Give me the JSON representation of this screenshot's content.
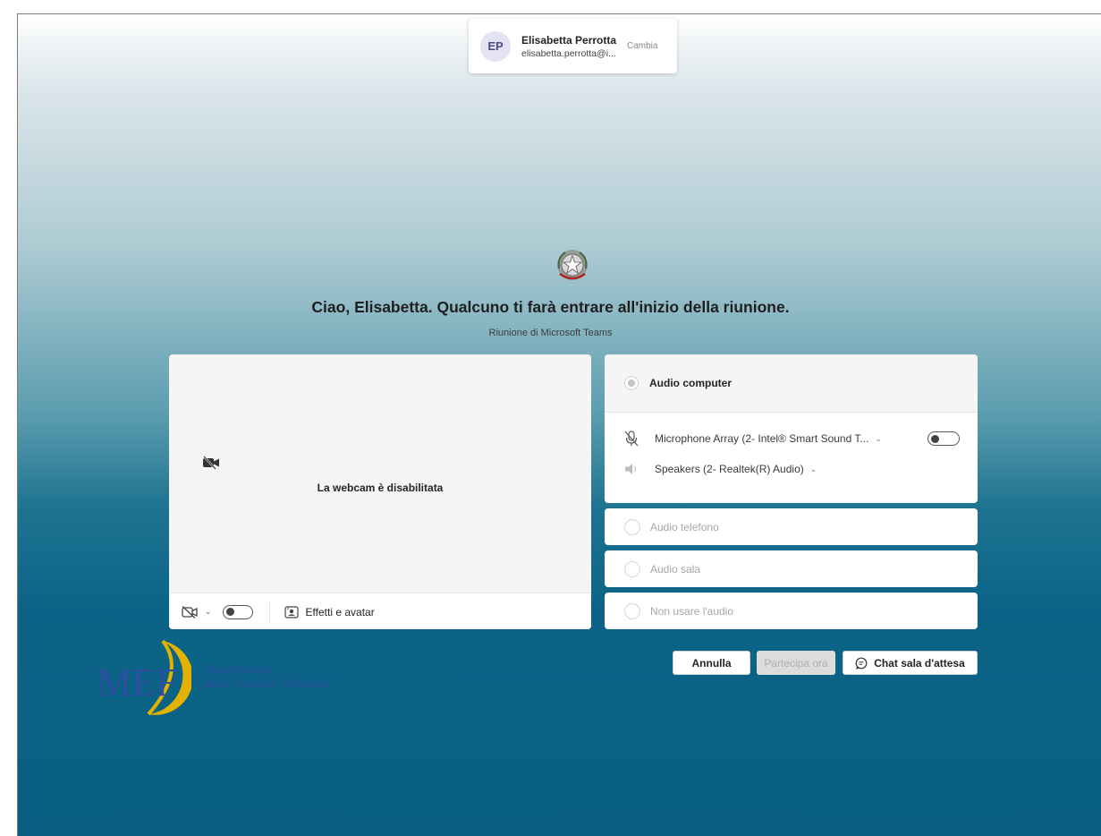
{
  "account": {
    "initials": "EP",
    "name": "Elisabetta Perrotta",
    "email": "elisabetta.perrotta@i...",
    "change_label": "Cambia"
  },
  "greeting": "Ciao, Elisabetta. Qualcuno ti farà entrare all'inizio della riunione.",
  "subtitle": "Riunione di Microsoft Teams",
  "video": {
    "disabled_message": "La webcam è disabilitata",
    "effects_label": "Effetti e avatar",
    "camera_on": false
  },
  "audio": {
    "selected_option": "Audio computer",
    "microphone": "Microphone Array (2- Intel® Smart Sound T...",
    "microphone_on": false,
    "speakers": "Speakers (2- Realtek(R) Audio)",
    "options": [
      "Audio telefono",
      "Audio sala",
      "Non usare l'audio"
    ]
  },
  "actions": {
    "cancel": "Annulla",
    "join": "Partecipa ora",
    "chat": "Chat sala d'attesa"
  },
  "logo": {
    "letters": "MEF",
    "dept_line1": "Dipartimento",
    "dept_line2": "della Giustizia Tributaria"
  },
  "colors": {
    "accent": "#5b5fc7",
    "logo_blue": "#2d4fa0",
    "logo_gold": "#e3b100",
    "disabled_text": "#a6a6a6"
  }
}
